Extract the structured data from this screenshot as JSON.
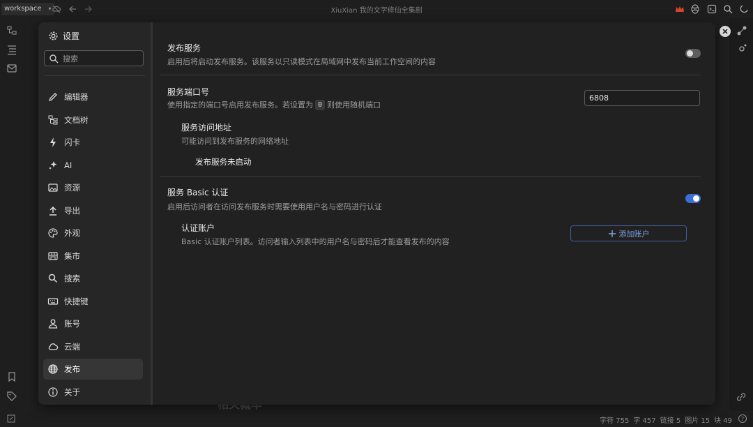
{
  "window": {
    "workspace_label": "workspace",
    "title": "XiuXian 我的文字修仙全集剧"
  },
  "dialog": {
    "title": "设置",
    "search_placeholder": "搜索",
    "nav": [
      {
        "label": "编辑器",
        "icon": "pencil-icon"
      },
      {
        "label": "文档树",
        "icon": "doc-tree-icon"
      },
      {
        "label": "闪卡",
        "icon": "flash-icon"
      },
      {
        "label": "AI",
        "icon": "sparkle-icon"
      },
      {
        "label": "资源",
        "icon": "image-icon"
      },
      {
        "label": "导出",
        "icon": "upload-icon"
      },
      {
        "label": "外观",
        "icon": "palette-icon"
      },
      {
        "label": "集市",
        "icon": "store-icon"
      },
      {
        "label": "搜索",
        "icon": "search-icon"
      },
      {
        "label": "快捷键",
        "icon": "keyboard-icon"
      },
      {
        "label": "账号",
        "icon": "user-icon"
      },
      {
        "label": "云端",
        "icon": "cloud-icon"
      },
      {
        "label": "发布",
        "icon": "globe-icon",
        "active": true
      },
      {
        "label": "关于",
        "icon": "info-icon"
      }
    ],
    "publish": {
      "service_title": "发布服务",
      "service_desc": "启用后将启动发布服务。该服务以只读模式在局域网中发布当前工作空间的内容",
      "service_enabled": false,
      "port_title": "服务端口号",
      "port_desc_before": "使用指定的端口号启用发布服务。若设置为",
      "port_desc_code": "0",
      "port_desc_after": "则使用随机端口",
      "port_value": "6808",
      "address_title": "服务访问地址",
      "address_desc": "可能访问到发布服务的网络地址",
      "address_status": "发布服务未启动",
      "auth_title": "服务 Basic 认证",
      "auth_desc": "启用后访问者在访问发布服务时需要使用用户名与密码进行认证",
      "auth_enabled": true,
      "accounts_title": "认证账户",
      "accounts_desc": "Basic 认证账户列表。访问者输入列表中的用户名与密码后才能查看发布的内容",
      "add_account_label": "添加账户"
    }
  },
  "background": {
    "heading_fragment": "相关概率"
  },
  "statusbar": {
    "chars": "字符 755",
    "words": "字 457",
    "links": "链接 5",
    "images": "图片 15",
    "blocks": "块 49"
  },
  "colors": {
    "accent": "#3b6fd6",
    "dialog_bg": "#212121",
    "sidebar_bg": "#262626"
  }
}
